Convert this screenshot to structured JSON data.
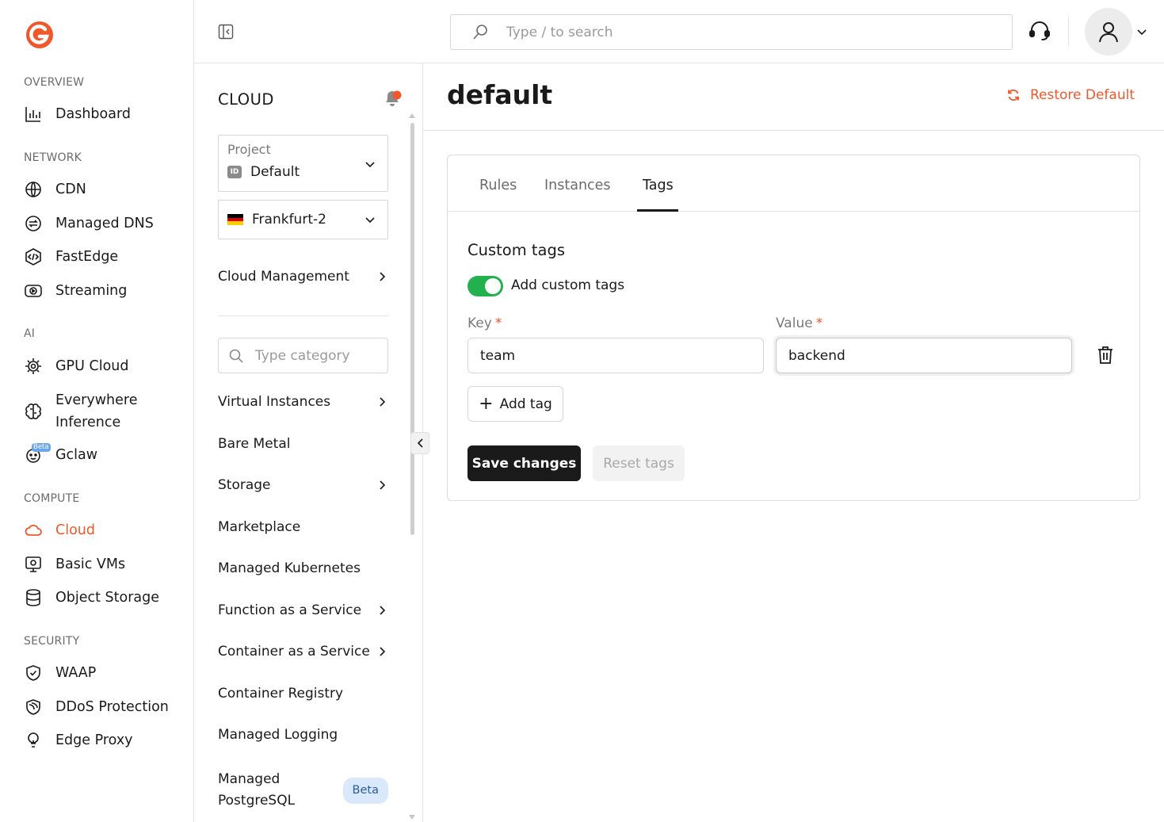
{
  "colors": {
    "accent": "#f0582b",
    "toggle_on": "#22b14c",
    "primary_button": "#1a1a1a"
  },
  "nav": {
    "sections": [
      {
        "title": "OVERVIEW",
        "items": [
          {
            "label": "Dashboard",
            "icon": "bar-chart-icon"
          }
        ]
      },
      {
        "title": "NETWORK",
        "items": [
          {
            "label": "CDN",
            "icon": "globe-icon"
          },
          {
            "label": "Managed DNS",
            "icon": "dns-icon"
          },
          {
            "label": "FastEdge",
            "icon": "code-icon"
          },
          {
            "label": "Streaming",
            "icon": "play-icon"
          }
        ]
      },
      {
        "title": "AI",
        "items": [
          {
            "label": "GPU Cloud",
            "icon": "chip-icon"
          },
          {
            "label": "Everywhere Inference",
            "icon": "brain-icon"
          },
          {
            "label": "Gclaw",
            "icon": "robot-icon",
            "badge": "Beta"
          }
        ]
      },
      {
        "title": "COMPUTE",
        "items": [
          {
            "label": "Cloud",
            "icon": "cloud-icon",
            "active": true
          },
          {
            "label": "Basic VMs",
            "icon": "monitor-icon"
          },
          {
            "label": "Object Storage",
            "icon": "database-icon"
          }
        ]
      },
      {
        "title": "SECURITY",
        "items": [
          {
            "label": "WAAP",
            "icon": "shield-icon"
          },
          {
            "label": "DDoS Protection",
            "icon": "ddos-shield-icon"
          },
          {
            "label": "Edge Proxy",
            "icon": "lightbulb-icon"
          }
        ]
      }
    ]
  },
  "topbar": {
    "search_placeholder": "Type / to search"
  },
  "cloud_panel": {
    "title": "CLOUD",
    "project": {
      "label": "Project",
      "value": "Default",
      "badge": "ID"
    },
    "region": {
      "value": "Frankfurt-2"
    },
    "cloud_management": "Cloud Management",
    "category_placeholder": "Type category",
    "items": [
      {
        "label": "Virtual Instances",
        "chevron": true
      },
      {
        "label": "Bare Metal",
        "chevron": false
      },
      {
        "label": "Storage",
        "chevron": true
      },
      {
        "label": "Marketplace",
        "chevron": false
      },
      {
        "label": "Managed Kubernetes",
        "chevron": false
      },
      {
        "label": "Function as a Service",
        "chevron": true
      },
      {
        "label": "Container as a Service",
        "chevron": true
      },
      {
        "label": "Container Registry",
        "chevron": false
      },
      {
        "label": "Managed Logging",
        "chevron": false
      },
      {
        "label": "Managed PostgreSQL",
        "chevron": false,
        "badge": "Beta"
      }
    ]
  },
  "main": {
    "title": "default",
    "restore_label": "Restore Default",
    "tabs": [
      {
        "label": "Rules"
      },
      {
        "label": "Instances"
      },
      {
        "label": "Tags",
        "active": true
      }
    ],
    "custom_tags": {
      "title": "Custom tags",
      "toggle_label": "Add custom tags",
      "toggle_on": true,
      "key_label": "Key",
      "value_label": "Value",
      "required_mark": "*",
      "key_value": "team",
      "value_value": "backend",
      "add_tag_label": "Add tag",
      "save_label": "Save changes",
      "reset_label": "Reset tags"
    }
  }
}
